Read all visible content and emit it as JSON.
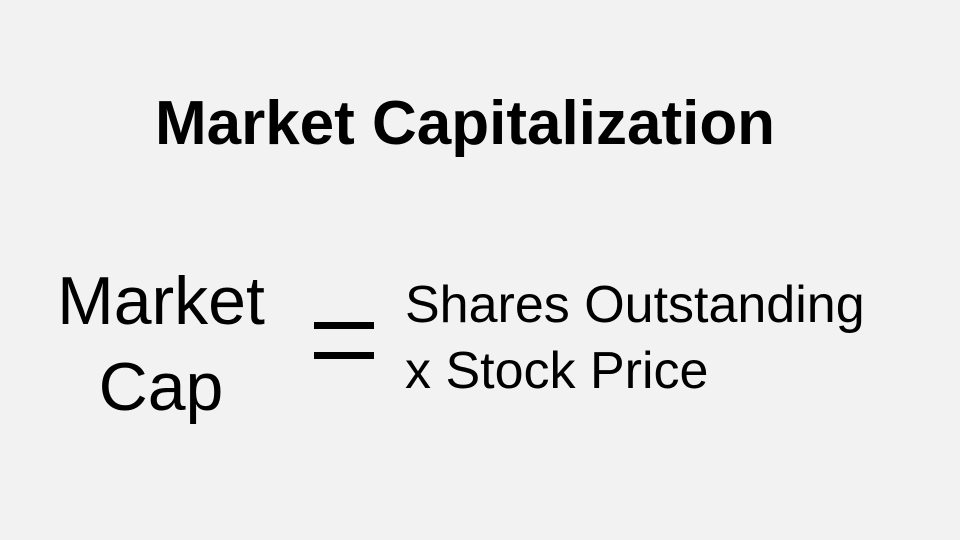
{
  "slide": {
    "title": "Market Capitalization",
    "formula": {
      "lhs_line1": "Market",
      "lhs_line2": "Cap",
      "operator": "=",
      "rhs_line1": "Shares Outstanding",
      "rhs_line2": "x Stock Price"
    }
  },
  "colors": {
    "background": "#f2f2f2",
    "text": "#000000"
  }
}
